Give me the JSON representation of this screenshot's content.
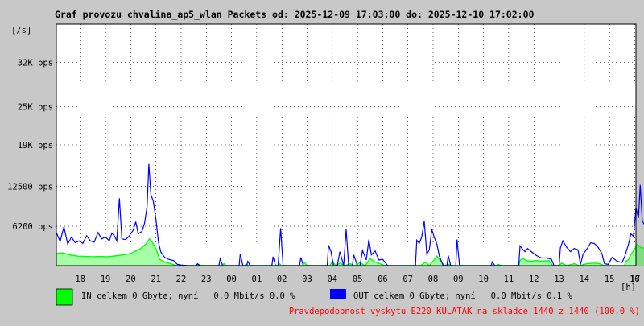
{
  "chart_data": {
    "type": "area",
    "title": "Graf provozu chvalina_ap5_wlan Packets od: 2025-12-09 17:03:00 do: 2025-12-10 17:02:00",
    "ylabel": "[/s]",
    "xlabel": "[h]",
    "ylim": [
      0,
      38000
    ],
    "xlim": [
      17.05,
      40.05
    ],
    "y_ticks": [
      {
        "value": 6200,
        "label": "6200 pps"
      },
      {
        "value": 12500,
        "label": "12500 pps"
      },
      {
        "value": 19000,
        "label": "19K pps"
      },
      {
        "value": 25000,
        "label": "25K pps"
      },
      {
        "value": 32000,
        "label": "32K pps"
      }
    ],
    "x_ticks": [
      {
        "value": 18,
        "label": "18"
      },
      {
        "value": 19,
        "label": "19"
      },
      {
        "value": 20,
        "label": "20"
      },
      {
        "value": 21,
        "label": "21"
      },
      {
        "value": 22,
        "label": "22"
      },
      {
        "value": 23,
        "label": "23"
      },
      {
        "value": 24,
        "label": "00"
      },
      {
        "value": 25,
        "label": "01"
      },
      {
        "value": 26,
        "label": "02"
      },
      {
        "value": 27,
        "label": "03"
      },
      {
        "value": 28,
        "label": "04"
      },
      {
        "value": 29,
        "label": "05"
      },
      {
        "value": 30,
        "label": "06"
      },
      {
        "value": 31,
        "label": "07"
      },
      {
        "value": 32,
        "label": "08"
      },
      {
        "value": 33,
        "label": "09"
      },
      {
        "value": 34,
        "label": "10"
      },
      {
        "value": 35,
        "label": "11"
      },
      {
        "value": 36,
        "label": "12"
      },
      {
        "value": 37,
        "label": "13"
      },
      {
        "value": 38,
        "label": "14"
      },
      {
        "value": 39,
        "label": "15"
      },
      {
        "value": 40,
        "label": "16"
      },
      {
        "value": 41,
        "label": "17"
      }
    ],
    "grid": true,
    "series": [
      {
        "name": "IN",
        "color": "#00ff00",
        "values": [
          [
            17.05,
            1900
          ],
          [
            17.3,
            2000
          ],
          [
            17.6,
            1700
          ],
          [
            17.9,
            1500
          ],
          [
            18.2,
            1450
          ],
          [
            18.5,
            1400
          ],
          [
            18.8,
            1450
          ],
          [
            19.1,
            1400
          ],
          [
            19.4,
            1550
          ],
          [
            19.7,
            1700
          ],
          [
            20.0,
            1900
          ],
          [
            20.2,
            2300
          ],
          [
            20.4,
            2700
          ],
          [
            20.6,
            3400
          ],
          [
            20.75,
            4200
          ],
          [
            20.85,
            3700
          ],
          [
            21.0,
            2700
          ],
          [
            21.15,
            1000
          ],
          [
            21.4,
            500
          ],
          [
            21.6,
            300
          ],
          [
            21.8,
            0
          ],
          [
            22.6,
            0
          ],
          [
            22.7,
            200
          ],
          [
            22.8,
            0
          ],
          [
            23.6,
            0
          ],
          [
            23.7,
            300
          ],
          [
            23.8,
            0
          ],
          [
            24.5,
            0
          ],
          [
            24.6,
            200
          ],
          [
            24.7,
            0
          ],
          [
            25.8,
            0
          ],
          [
            25.9,
            300
          ],
          [
            26.0,
            0
          ],
          [
            26.8,
            0
          ],
          [
            26.9,
            500
          ],
          [
            27.0,
            0
          ],
          [
            27.9,
            0
          ],
          [
            28.0,
            600
          ],
          [
            28.15,
            0
          ],
          [
            28.3,
            400
          ],
          [
            28.5,
            0
          ],
          [
            28.7,
            300
          ],
          [
            28.9,
            0
          ],
          [
            29.1,
            500
          ],
          [
            29.3,
            0
          ],
          [
            29.5,
            1100
          ],
          [
            29.7,
            600
          ],
          [
            29.9,
            300
          ],
          [
            30.1,
            0
          ],
          [
            31.5,
            0
          ],
          [
            31.7,
            600
          ],
          [
            31.85,
            0
          ],
          [
            32.0,
            700
          ],
          [
            32.15,
            1500
          ],
          [
            32.3,
            700
          ],
          [
            32.45,
            0
          ],
          [
            32.6,
            200
          ],
          [
            32.75,
            0
          ],
          [
            34.5,
            0
          ],
          [
            34.6,
            200
          ],
          [
            34.7,
            0
          ],
          [
            35.4,
            0
          ],
          [
            35.45,
            800
          ],
          [
            35.55,
            1200
          ],
          [
            35.7,
            800
          ],
          [
            35.9,
            700
          ],
          [
            36.1,
            800
          ],
          [
            36.3,
            700
          ],
          [
            36.6,
            800
          ],
          [
            36.75,
            0
          ],
          [
            37.0,
            0
          ],
          [
            37.1,
            400
          ],
          [
            37.3,
            0
          ],
          [
            37.6,
            300
          ],
          [
            37.8,
            0
          ],
          [
            38.1,
            300
          ],
          [
            38.4,
            400
          ],
          [
            38.6,
            300
          ],
          [
            38.8,
            0
          ],
          [
            39.6,
            0
          ],
          [
            39.65,
            700
          ],
          [
            39.75,
            900
          ],
          [
            39.85,
            1800
          ],
          [
            39.95,
            2300
          ],
          [
            40.1,
            3300
          ],
          [
            40.3,
            2700
          ],
          [
            40.5,
            3200
          ],
          [
            40.7,
            2900
          ],
          [
            40.9,
            3700
          ],
          [
            41.05,
            3600
          ]
        ]
      },
      {
        "name": "OUT",
        "color": "#0000ff",
        "values": [
          [
            17.05,
            5200
          ],
          [
            17.2,
            3800
          ],
          [
            17.35,
            6100
          ],
          [
            17.5,
            3400
          ],
          [
            17.65,
            4500
          ],
          [
            17.8,
            3600
          ],
          [
            17.95,
            3900
          ],
          [
            18.1,
            3500
          ],
          [
            18.25,
            4700
          ],
          [
            18.4,
            3900
          ],
          [
            18.55,
            3700
          ],
          [
            18.7,
            5200
          ],
          [
            18.85,
            4200
          ],
          [
            19.0,
            4500
          ],
          [
            19.15,
            3900
          ],
          [
            19.25,
            5100
          ],
          [
            19.35,
            4700
          ],
          [
            19.45,
            3900
          ],
          [
            19.55,
            10600
          ],
          [
            19.65,
            4200
          ],
          [
            19.8,
            4100
          ],
          [
            19.95,
            4700
          ],
          [
            20.1,
            5600
          ],
          [
            20.2,
            6900
          ],
          [
            20.3,
            5000
          ],
          [
            20.45,
            5400
          ],
          [
            20.55,
            6700
          ],
          [
            20.65,
            9300
          ],
          [
            20.72,
            16000
          ],
          [
            20.8,
            11200
          ],
          [
            20.9,
            10100
          ],
          [
            21.0,
            7300
          ],
          [
            21.1,
            3700
          ],
          [
            21.2,
            2100
          ],
          [
            21.35,
            1300
          ],
          [
            21.5,
            1000
          ],
          [
            21.7,
            800
          ],
          [
            21.85,
            200
          ],
          [
            22.0,
            100
          ],
          [
            22.3,
            0
          ],
          [
            22.6,
            0
          ],
          [
            22.65,
            300
          ],
          [
            22.75,
            0
          ],
          [
            23.5,
            0
          ],
          [
            23.55,
            1100
          ],
          [
            23.65,
            0
          ],
          [
            24.3,
            0
          ],
          [
            24.35,
            1900
          ],
          [
            24.45,
            0
          ],
          [
            24.6,
            0
          ],
          [
            24.65,
            700
          ],
          [
            24.75,
            0
          ],
          [
            25.6,
            0
          ],
          [
            25.65,
            1400
          ],
          [
            25.75,
            0
          ],
          [
            25.85,
            0
          ],
          [
            25.95,
            5900
          ],
          [
            26.05,
            0
          ],
          [
            26.7,
            0
          ],
          [
            26.75,
            1300
          ],
          [
            26.85,
            0
          ],
          [
            27.8,
            0
          ],
          [
            27.85,
            3200
          ],
          [
            27.95,
            2200
          ],
          [
            28.05,
            0
          ],
          [
            28.2,
            0
          ],
          [
            28.3,
            2200
          ],
          [
            28.45,
            0
          ],
          [
            28.55,
            5700
          ],
          [
            28.65,
            0
          ],
          [
            28.8,
            0
          ],
          [
            28.85,
            1700
          ],
          [
            29.0,
            0
          ],
          [
            29.1,
            0
          ],
          [
            29.2,
            2400
          ],
          [
            29.35,
            900
          ],
          [
            29.45,
            4100
          ],
          [
            29.55,
            1700
          ],
          [
            29.7,
            2300
          ],
          [
            29.85,
            900
          ],
          [
            30.0,
            1000
          ],
          [
            30.2,
            0
          ],
          [
            31.3,
            0
          ],
          [
            31.35,
            4000
          ],
          [
            31.45,
            3500
          ],
          [
            31.55,
            4500
          ],
          [
            31.65,
            7000
          ],
          [
            31.75,
            1800
          ],
          [
            31.85,
            2500
          ],
          [
            31.95,
            5700
          ],
          [
            32.05,
            4400
          ],
          [
            32.15,
            3400
          ],
          [
            32.25,
            1500
          ],
          [
            32.4,
            0
          ],
          [
            32.55,
            0
          ],
          [
            32.6,
            1600
          ],
          [
            32.7,
            0
          ],
          [
            32.9,
            0
          ],
          [
            32.95,
            4100
          ],
          [
            33.05,
            0
          ],
          [
            34.3,
            0
          ],
          [
            34.35,
            600
          ],
          [
            34.45,
            0
          ],
          [
            35.4,
            0
          ],
          [
            35.45,
            3100
          ],
          [
            35.55,
            2600
          ],
          [
            35.65,
            2200
          ],
          [
            35.75,
            2700
          ],
          [
            35.9,
            2200
          ],
          [
            36.1,
            1600
          ],
          [
            36.3,
            1200
          ],
          [
            36.5,
            1200
          ],
          [
            36.7,
            1000
          ],
          [
            36.8,
            0
          ],
          [
            37.0,
            0
          ],
          [
            37.05,
            2800
          ],
          [
            37.15,
            3900
          ],
          [
            37.3,
            2900
          ],
          [
            37.45,
            2200
          ],
          [
            37.6,
            2700
          ],
          [
            37.75,
            2500
          ],
          [
            37.85,
            200
          ],
          [
            37.95,
            1800
          ],
          [
            38.1,
            2600
          ],
          [
            38.25,
            3600
          ],
          [
            38.4,
            3500
          ],
          [
            38.55,
            2900
          ],
          [
            38.7,
            1900
          ],
          [
            38.8,
            300
          ],
          [
            38.95,
            200
          ],
          [
            39.1,
            1300
          ],
          [
            39.3,
            700
          ],
          [
            39.5,
            500
          ],
          [
            39.6,
            1400
          ],
          [
            39.75,
            3300
          ],
          [
            39.85,
            5000
          ],
          [
            39.95,
            4600
          ],
          [
            40.05,
            9100
          ],
          [
            40.15,
            7500
          ],
          [
            40.22,
            12700
          ],
          [
            40.3,
            7100
          ],
          [
            40.4,
            6300
          ],
          [
            40.55,
            9700
          ],
          [
            40.7,
            6900
          ],
          [
            40.85,
            5800
          ],
          [
            40.95,
            8600
          ],
          [
            41.05,
            7200
          ]
        ]
      }
    ],
    "legend": [
      {
        "label": "IN celkem 0 Gbyte; nyní   0.0 Mbit/s 0.0 %",
        "color": "#00ff00"
      },
      {
        "label": "OUT celkem 0 Gbyte; nyní   0.0 Mbit/s 0.1 %",
        "color": "#0000ff"
      }
    ],
    "footer": {
      "text": "Pravdepodobnost vyskytu E220 KULATAK na skladce 1440 z 1440 (100.0 %)",
      "color": "#ff0000"
    }
  }
}
